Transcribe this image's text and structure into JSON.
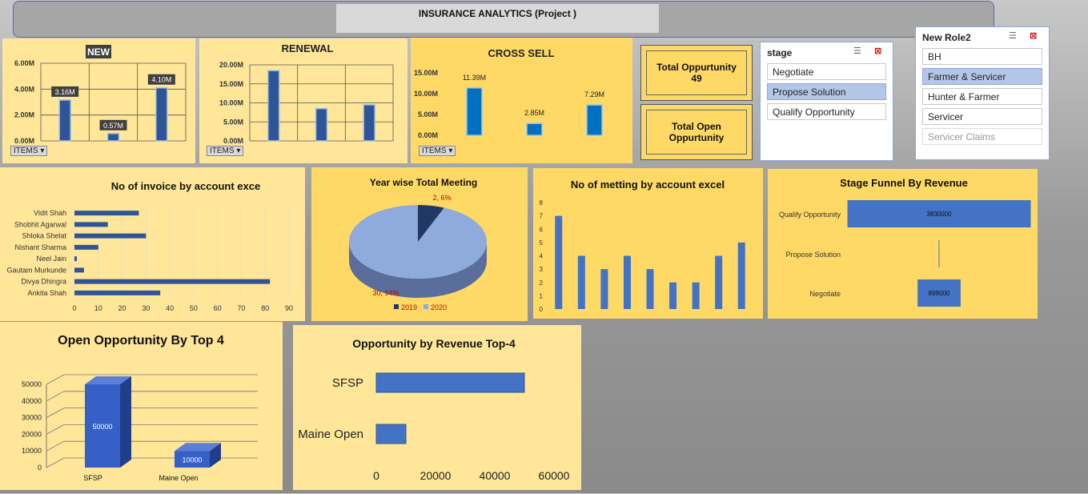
{
  "header": {
    "title": "INSURANCE ANALYTICS (Project )"
  },
  "items_label": "ITEMS",
  "new_chart": {
    "title": "NEW",
    "ticks": [
      "6.00M",
      "4.00M",
      "2.00M",
      "0.00M"
    ],
    "chart_data": {
      "type": "bar",
      "title": "NEW",
      "values": [
        3.16,
        0.57,
        4.1
      ],
      "labels": [
        "3.16M",
        "0.57M",
        "4.10M"
      ],
      "ylim": [
        0,
        6
      ]
    }
  },
  "renewal_chart": {
    "title": "RENEWAL",
    "ticks": [
      "20.00M",
      "15.00M",
      "10.00M",
      "5.00M",
      "0.00M"
    ],
    "chart_data": {
      "type": "bar",
      "title": "RENEWAL",
      "values": [
        18.5,
        8.5,
        9.5
      ],
      "ylim": [
        0,
        20
      ]
    }
  },
  "cross_sell_chart": {
    "title": "CROSS SELL",
    "ticks": [
      "15.00M",
      "10.00M",
      "5.00M",
      "0.00M"
    ],
    "chart_data": {
      "type": "bar",
      "title": "CROSS SELL",
      "values": [
        11.39,
        2.85,
        7.29
      ],
      "labels": [
        "11.39M",
        "2.85M",
        "7.29M"
      ],
      "ylim": [
        0,
        15
      ]
    }
  },
  "kpis": {
    "total_opportunity_label": "Total  Oppurtunity",
    "total_opportunity_value": "49",
    "total_open_label": "Total Open Oppurtunity"
  },
  "stage_slicer": {
    "title": "stage",
    "items": [
      "Negotiate",
      "Propose Solution",
      "Qualify Opportunity"
    ],
    "selected": "Propose Solution",
    "filter_icon": "multi-select-icon",
    "clear_icon": "clear-filter-icon"
  },
  "role_slicer": {
    "title": "New Role2",
    "items": [
      "BH",
      "Farmer & Servicer",
      "Hunter & Farmer",
      "Servicer",
      "Servicer Claims"
    ],
    "selected": "Farmer & Servicer",
    "dim": "Servicer Claims"
  },
  "invoice_chart": {
    "title": "No of invoice by account exce",
    "chart_data": {
      "type": "bar",
      "orientation": "horizontal",
      "title": "No of invoice by account exce",
      "categories": [
        "Vidit Shah",
        "Shobhit Agarwal",
        "Shloka Shelat",
        "Nishant Sharma",
        "Neel Jain",
        "Gautam Murkunde",
        "Divya Dhingra",
        "Ankita Shah"
      ],
      "values": [
        27,
        14,
        30,
        10,
        1,
        4,
        82,
        36
      ],
      "xticks": [
        "0",
        "10",
        "20",
        "30",
        "40",
        "50",
        "60",
        "70",
        "80",
        "90"
      ],
      "xlim": [
        0,
        90
      ]
    }
  },
  "meeting_pie": {
    "title": "Year wise Total Meeting",
    "chart_data": {
      "type": "pie",
      "title": "Year wise Total Meeting",
      "series": [
        {
          "name": "2019",
          "value": 2,
          "label": "2, 6%",
          "color": "#1f3864"
        },
        {
          "name": "2020",
          "value": 30,
          "label": "30, 94%",
          "color": "#8faadc"
        }
      ]
    }
  },
  "meeting_bar": {
    "title": "No of metting by account excel",
    "chart_data": {
      "type": "bar",
      "title": "No of metting by account excel",
      "values": [
        7,
        4,
        3,
        4,
        3,
        2,
        2,
        4,
        5
      ],
      "yticks": [
        "8",
        "7",
        "6",
        "5",
        "4",
        "3",
        "2",
        "1",
        "0"
      ],
      "ylim": [
        0,
        8
      ]
    }
  },
  "funnel": {
    "title": "Stage Funnel By Revenue",
    "chart_data": {
      "type": "bar",
      "orientation": "horizontal",
      "title": "Stage Funnel By Revenue",
      "categories": [
        "Qualify Opportunity",
        "Propose Solution",
        "Negotiate"
      ],
      "values": [
        3830000,
        0,
        899000
      ],
      "labels": [
        "3830000",
        "",
        "899000"
      ]
    }
  },
  "open_opp": {
    "title": "Open Opportunity By Top 4",
    "chart_data": {
      "type": "bar",
      "title": "Open Opportunity By Top 4",
      "categories": [
        "SFSP",
        "Maine Open"
      ],
      "values": [
        50000,
        10000
      ],
      "labels": [
        "50000",
        "10000"
      ],
      "yticks": [
        "50000",
        "40000",
        "30000",
        "20000",
        "10000",
        "0"
      ],
      "ylim": [
        0,
        50000
      ]
    }
  },
  "opp_revenue": {
    "title": "Opportunity by Revenue Top-4",
    "chart_data": {
      "type": "bar",
      "orientation": "horizontal",
      "title": "Opportunity by Revenue Top-4",
      "categories": [
        "SFSP",
        "Maine Open"
      ],
      "values": [
        50000,
        10000
      ],
      "xticks": [
        "0",
        "20000",
        "40000",
        "60000"
      ],
      "xlim": [
        0,
        60000
      ]
    }
  },
  "colors": {
    "panel": "#ffe699",
    "panel_dark": "#ffd966",
    "bar_blue": "#2f5597",
    "bar_bright": "#0070c0",
    "funnel_blue": "#4472c4"
  }
}
